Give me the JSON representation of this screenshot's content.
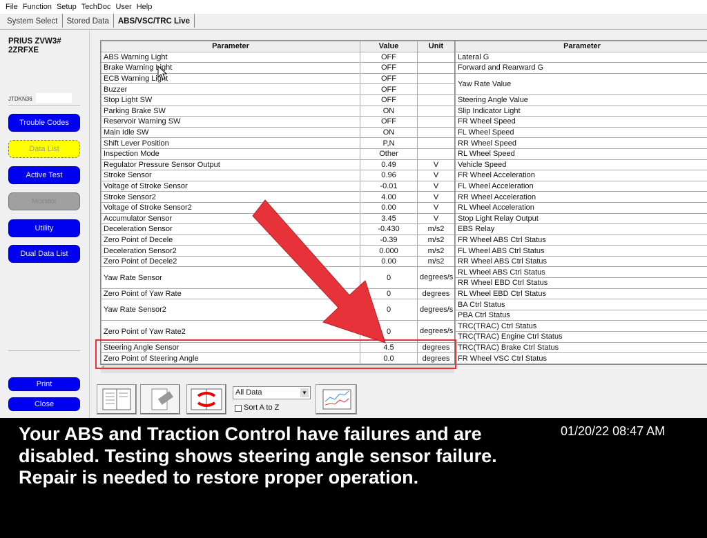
{
  "menu": [
    "File",
    "Function",
    "Setup",
    "TechDoc",
    "User",
    "Help"
  ],
  "tabs": [
    "System Select",
    "Stored Data",
    "ABS/VSC/TRC Live"
  ],
  "vehicle": {
    "model": "PRIUS ZVW3# 2ZRFXE",
    "vin": "JTDKN36"
  },
  "nav": {
    "trouble_codes": "Trouble Codes",
    "data_list": "Data List",
    "active_test": "Active Test",
    "monitor": "Monitor",
    "utility": "Utility",
    "dual_data_list": "Dual Data List",
    "print": "Print",
    "close": "Close"
  },
  "left_table": {
    "headers": [
      "Parameter",
      "Value",
      "Unit"
    ],
    "rows": [
      [
        "ABS Warning Light",
        "OFF",
        ""
      ],
      [
        "Brake Warning Light",
        "OFF",
        ""
      ],
      [
        "ECB Warning Light",
        "OFF",
        ""
      ],
      [
        "Buzzer",
        "OFF",
        ""
      ],
      [
        "Stop Light SW",
        "OFF",
        ""
      ],
      [
        "Parking Brake SW",
        "ON",
        ""
      ],
      [
        "Reservoir Warning SW",
        "OFF",
        ""
      ],
      [
        "Main Idle SW",
        "ON",
        ""
      ],
      [
        "Shift Lever Position",
        "P,N",
        ""
      ],
      [
        "Inspection Mode",
        "Other",
        ""
      ],
      [
        "Regulator Pressure Sensor Output",
        "0.49",
        "V"
      ],
      [
        "Stroke Sensor",
        "0.96",
        "V"
      ],
      [
        "Voltage of Stroke Sensor",
        "-0.01",
        "V"
      ],
      [
        "Stroke Sensor2",
        "4.00",
        "V"
      ],
      [
        "Voltage of Stroke Sensor2",
        "0.00",
        "V"
      ],
      [
        "Accumulator Sensor",
        "3.45",
        "V"
      ],
      [
        "Deceleration Sensor",
        "-0.430",
        "m/s2"
      ],
      [
        "Zero Point of Decele",
        "-0.39",
        "m/s2"
      ],
      [
        "Deceleration Sensor2",
        "0.000",
        "m/s2"
      ],
      [
        "Zero Point of Decele2",
        "0.00",
        "m/s2"
      ],
      [
        "Yaw Rate Sensor",
        "0",
        "degrees/s"
      ],
      [
        "Zero Point of Yaw Rate",
        "0",
        "degrees"
      ],
      [
        "Yaw Rate Sensor2",
        "0",
        "degrees/s"
      ],
      [
        "Zero Point of Yaw Rate2",
        "0",
        "degrees/s"
      ],
      [
        "Steering Angle Sensor",
        "4.5",
        "degrees"
      ],
      [
        "Zero Point of Steering Angle",
        "0.0",
        "degrees"
      ]
    ]
  },
  "right_table": {
    "header": "Parameter",
    "rows": [
      "Lateral G",
      "Forward and Rearward G",
      "Yaw Rate Value",
      "Steering Angle Value",
      "Slip Indicator Light",
      "FR Wheel Speed",
      "FL Wheel Speed",
      "RR Wheel Speed",
      "RL Wheel Speed",
      "Vehicle Speed",
      "FR Wheel Acceleration",
      "FL Wheel Acceleration",
      "RR Wheel Acceleration",
      "RL Wheel Acceleration",
      "Stop Light Relay Output",
      "EBS Relay",
      "FR Wheel ABS Ctrl Status",
      "FL Wheel ABS Ctrl Status",
      "RR Wheel ABS Ctrl Status",
      "RL Wheel ABS Ctrl Status",
      "RR Wheel EBD Ctrl Status",
      "RL Wheel EBD Ctrl Status",
      "BA Ctrl Status",
      "PBA Ctrl Status",
      "TRC(TRAC) Ctrl Status",
      "TRC(TRAC) Engine Ctrl Status",
      "TRC(TRAC) Brake Ctrl Status",
      "FR Wheel VSC Ctrl Status"
    ]
  },
  "toolbar": {
    "dropdown_value": "All Data",
    "sort_label": "Sort A to Z",
    "sort_checked": false
  },
  "highlight_color": "#e8323a",
  "caption": "Your ABS and Traction Control have failures and are disabled. Testing shows steering angle sensor failure. Repair is needed to restore proper operation.",
  "timestamp": "01/20/22 08:47 AM"
}
